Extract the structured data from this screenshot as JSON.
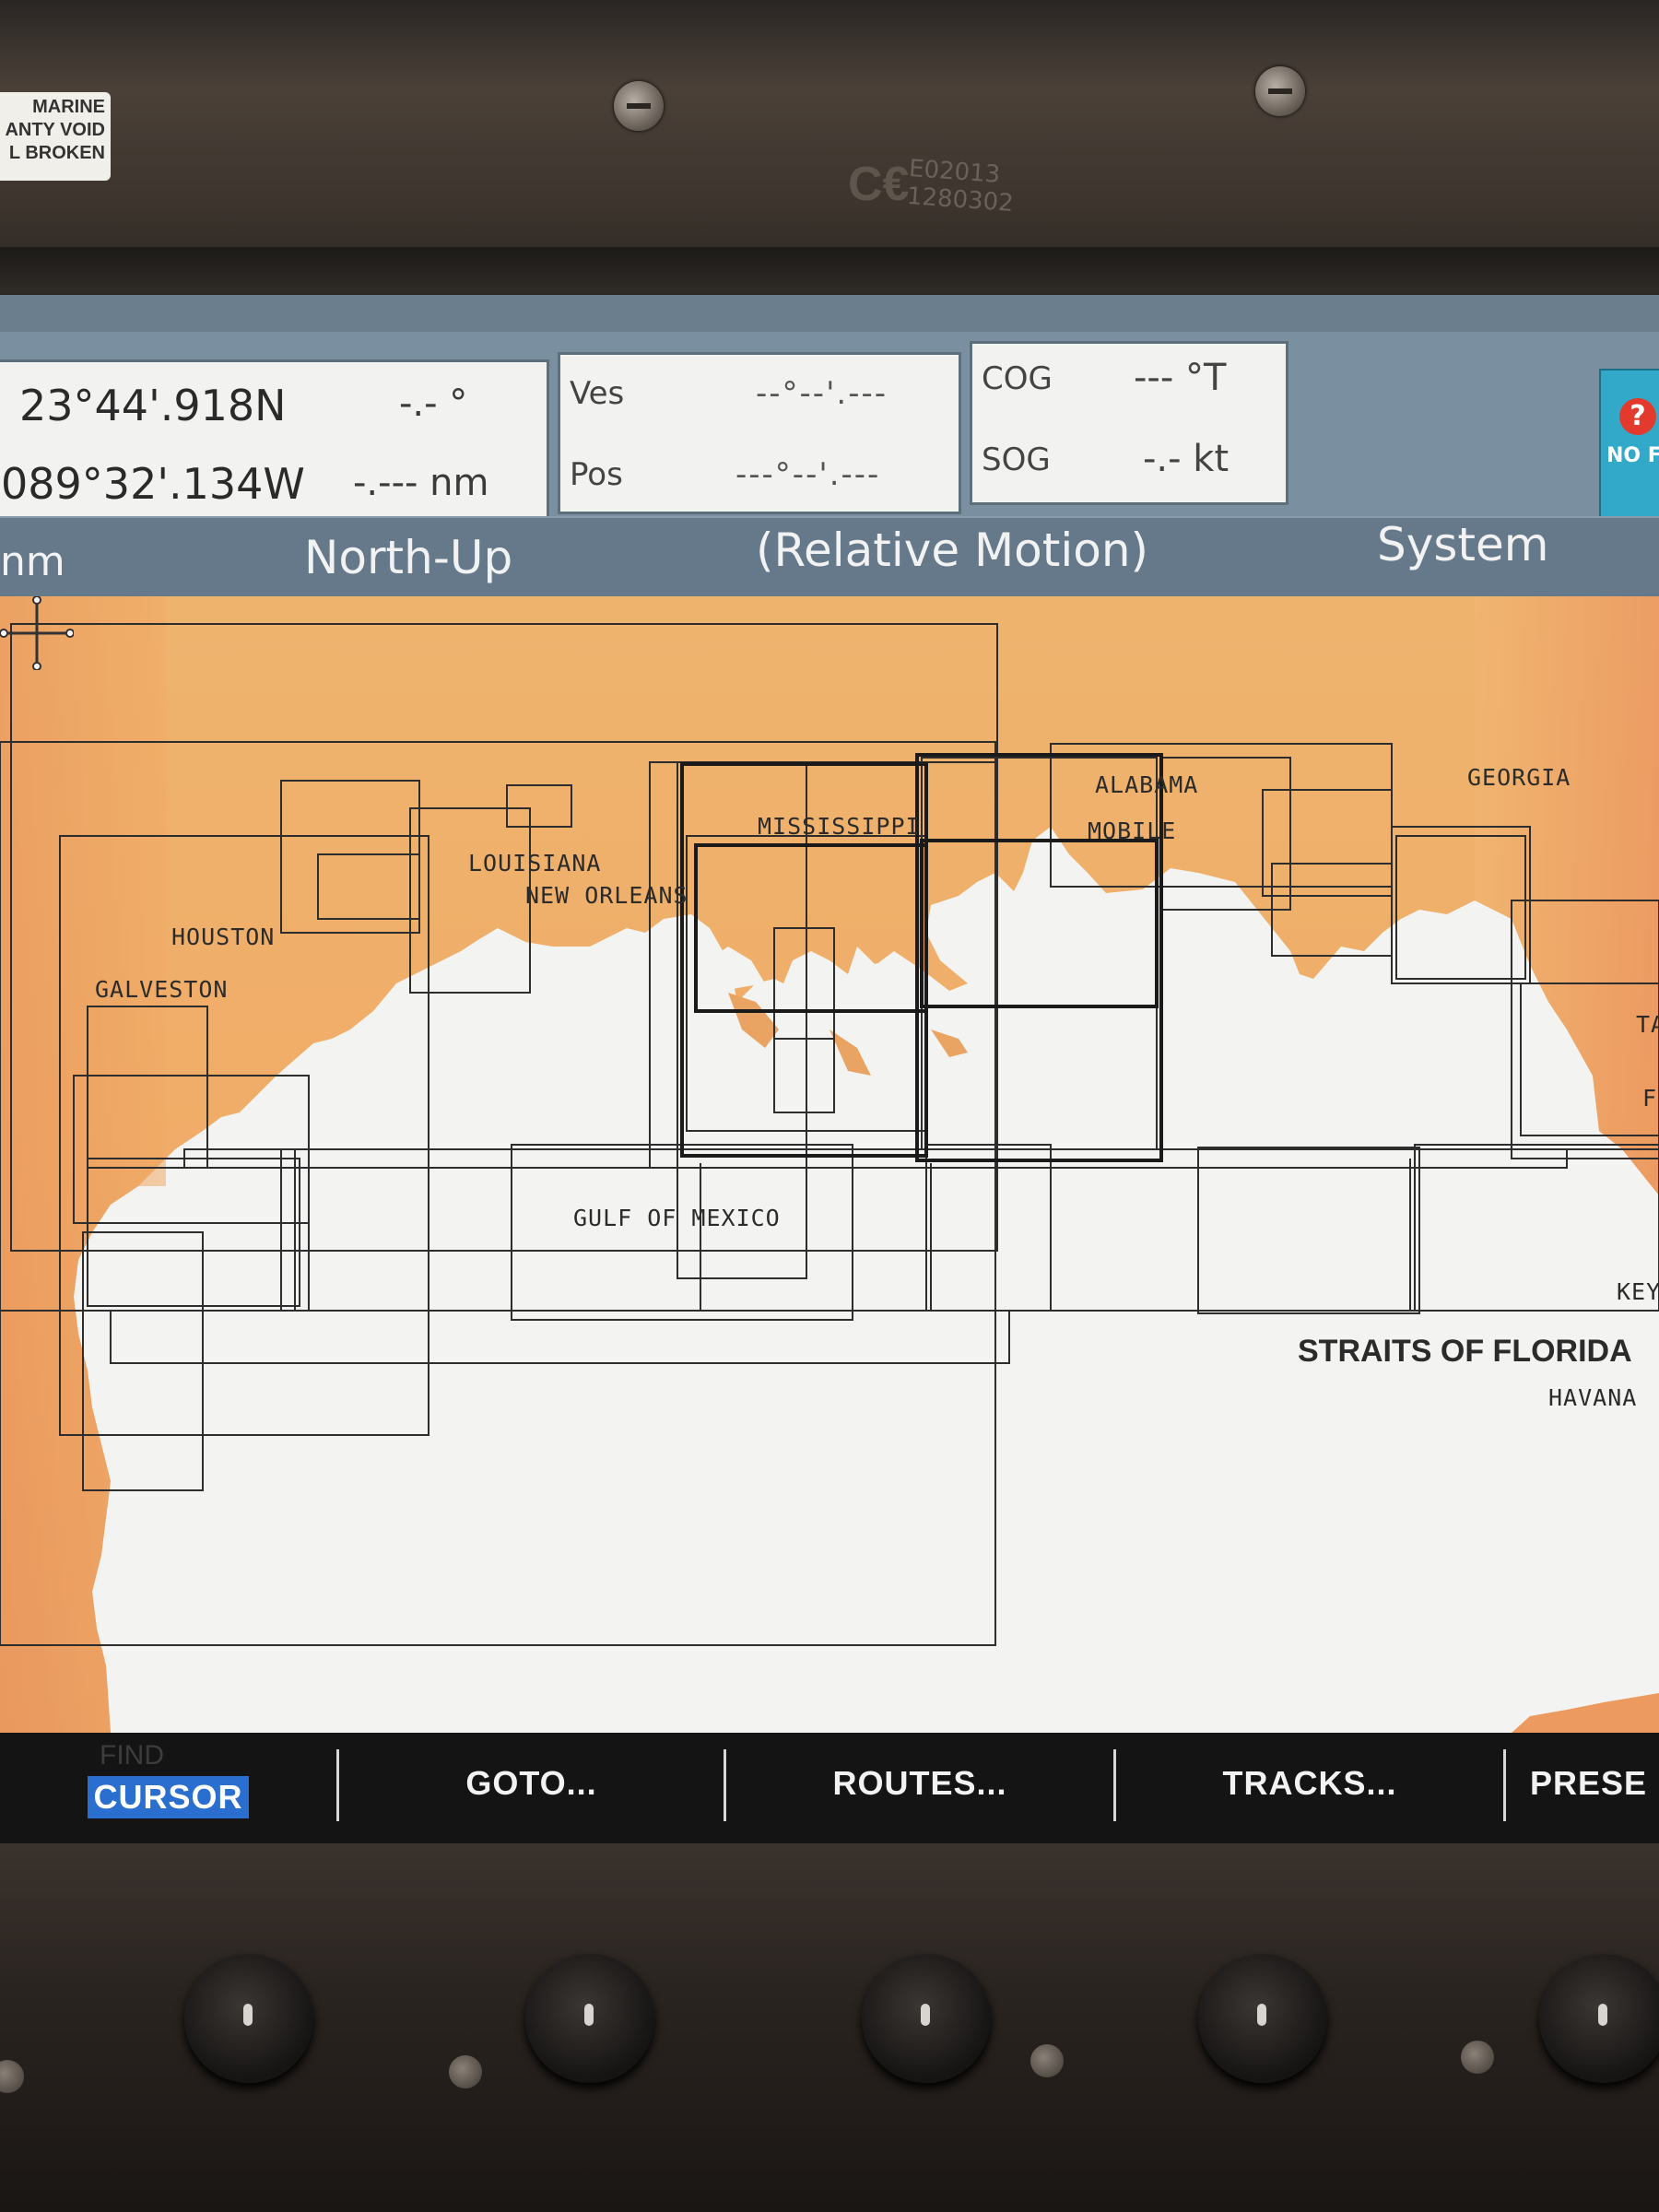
{
  "device": {
    "warranty_label": [
      "MARINE",
      "ANTY VOID",
      "L BROKEN"
    ],
    "ce_mark": "C€",
    "ce_code": [
      "E02013",
      "1280302"
    ]
  },
  "position_panel": {
    "lat": "23°44'.918N",
    "lon": "089°32'.134W",
    "bearing": "-.- °",
    "distance": "-.--- nm"
  },
  "vessel_panel": {
    "ves_label": "Ves",
    "ves_value": "--°--'.---",
    "pos_label": "Pos",
    "pos_value": "---°--'.---"
  },
  "nav_panel": {
    "cog_label": "COG",
    "cog_value": "--- °T",
    "sog_label": "SOG",
    "sog_value": "-.- kt"
  },
  "status_badge": {
    "text": "NO F",
    "symbol": "?"
  },
  "mode_bar": {
    "range_unit": "nm",
    "orientation": "North-Up",
    "motion": "(Relative Motion)",
    "system": "System"
  },
  "map_labels": {
    "alabama": "ALABAMA",
    "georgia": "GEORGIA",
    "mississippi": "MISSISSIPPI",
    "mobile": "MOBILE",
    "louisiana": "LOUISIANA",
    "new_orleans": "NEW ORLEANS",
    "houston": "HOUSTON",
    "galveston": "GALVESTON",
    "gulf": "GULF OF MEXICO",
    "straits": "STRAITS OF FLORIDA",
    "havana": "HAVANA",
    "key": "KEY",
    "ta": "TA",
    "f": "F"
  },
  "softkeys": {
    "find_faint": "FIND",
    "cursor": "CURSOR",
    "goto": "GOTO...",
    "routes": "ROUTES...",
    "tracks": "TRACKS...",
    "presets": "PRESE"
  },
  "colors": {
    "land": "#f0b06c",
    "water": "#f3f4f1",
    "bar": "#65798b",
    "cursor_highlight": "#2a6fcf"
  }
}
